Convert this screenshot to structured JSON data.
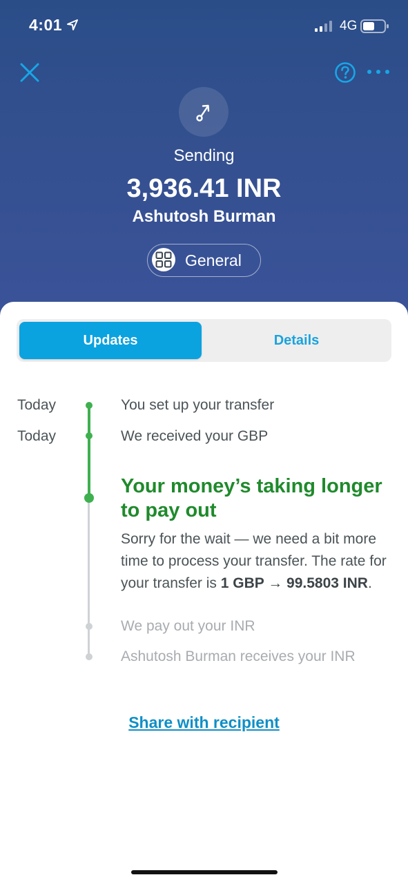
{
  "status_bar": {
    "time": "4:01",
    "network": "4G"
  },
  "header": {
    "status": "Sending",
    "amount": "3,936.41 INR",
    "recipient": "Ashutosh Burman",
    "category": "General"
  },
  "tabs": {
    "updates": "Updates",
    "details": "Details",
    "active": "Updates"
  },
  "timeline": {
    "steps": [
      {
        "day": "Today",
        "text": "You set up your transfer"
      },
      {
        "day": "Today",
        "text": "We received your GBP"
      }
    ],
    "alert": {
      "title": "Your money’s taking longer to pay out",
      "body_prefix": "Sorry for the wait — we need a bit more time to process your transfer. The rate for your transfer is ",
      "rate": "1 GBP → 99.5803 INR",
      "body_suffix": "."
    },
    "pending_steps": [
      {
        "text": "We pay out your INR"
      },
      {
        "text": "Ashutosh Burman receives your INR"
      }
    ]
  },
  "share_link": "Share with recipient",
  "colors": {
    "header_bg": "#34508f",
    "accent_blue": "#0ba2e0",
    "success_green": "#3fb04f",
    "alert_green": "#1f8a2c"
  }
}
